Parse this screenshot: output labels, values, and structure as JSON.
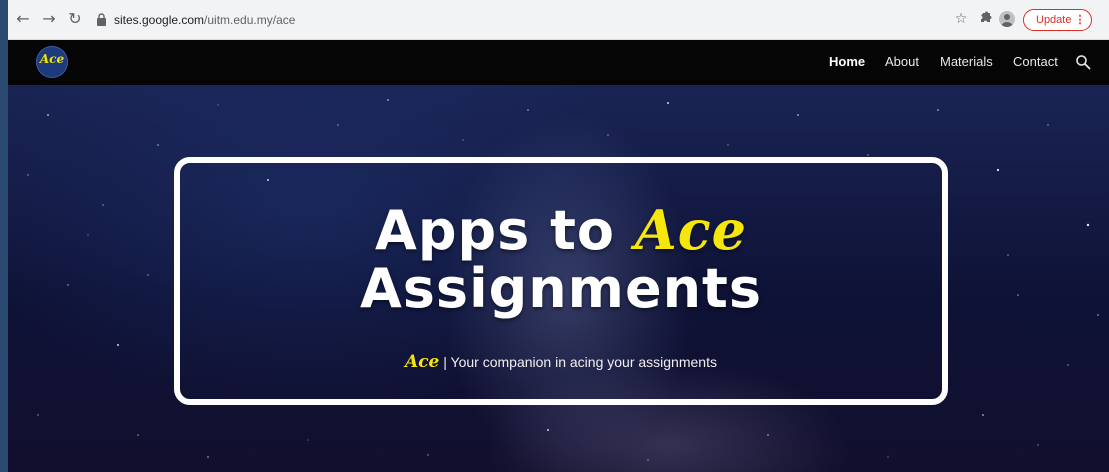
{
  "browser": {
    "url_host": "sites.google.com",
    "url_path": "/uitm.edu.my/ace",
    "update_label": "Update",
    "update_menu": "⋮",
    "colors": {
      "update_accent": "#d93025"
    }
  },
  "site": {
    "logo_text": "Ace",
    "nav": {
      "home": "Home",
      "about": "About",
      "materials": "Materials",
      "contact": "Contact"
    }
  },
  "hero": {
    "headline_part1": "Apps to ",
    "headline_brand": "Ace",
    "headline_line2": "Assignments",
    "tagline_brand": "Ace",
    "tagline_separator": " | ",
    "tagline_text": "Your companion in acing your assignments",
    "colors": {
      "brand_yellow": "#f5e60c",
      "frame": "#ffffff"
    }
  }
}
